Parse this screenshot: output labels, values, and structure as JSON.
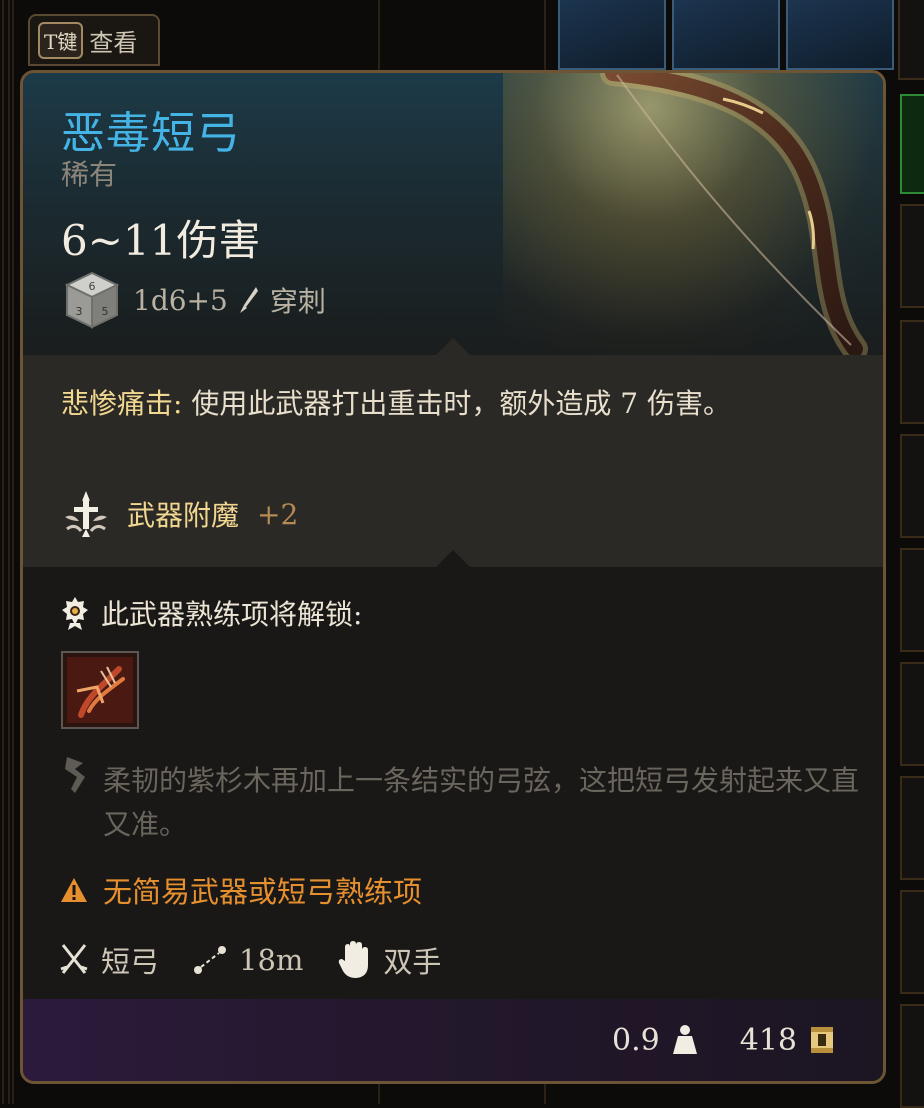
{
  "view_tag": {
    "key": "T键",
    "label": "查看"
  },
  "item": {
    "name": "恶毒短弓",
    "rarity": "稀有",
    "damage": "6~11伤害",
    "dice": "1d6+5",
    "damage_type": "穿刺"
  },
  "effects": {
    "passive_name": "悲惨痛击:",
    "passive_text": " 使用此武器打出重击时，额外造成 7 伤害。",
    "enchant_label": "武器附魔",
    "enchant_value": "+2"
  },
  "unlock": {
    "label": "此武器熟练项将解锁:"
  },
  "lore": "柔韧的紫杉木再加上一条结实的弓弦，这把短弓发射起来又直又准。",
  "warning": "无简易武器或短弓熟练项",
  "properties": {
    "weapon_type": "短弓",
    "range": "18m",
    "handedness": "双手"
  },
  "footer": {
    "weight": "0.9",
    "value": "418"
  },
  "colors": {
    "name": "#44b4e6",
    "gold_text": "#f1d891",
    "warning": "#e58f2f",
    "rarity": "#8c857a"
  }
}
